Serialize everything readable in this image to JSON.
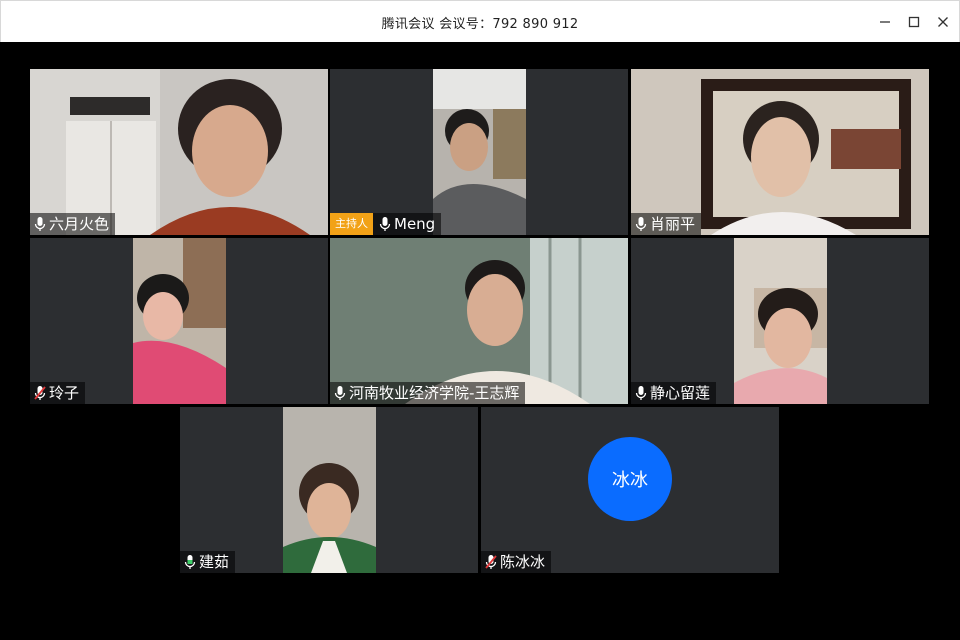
{
  "window": {
    "title": "腾讯会议 会议号：792 890 912"
  },
  "participants": [
    {
      "name": "六月火色",
      "mic": "on"
    },
    {
      "name": "Meng",
      "mic": "on",
      "host_badge": "主持人"
    },
    {
      "name": "肖丽平",
      "mic": "on"
    },
    {
      "name": "玲子",
      "mic": "muted"
    },
    {
      "name": "河南牧业经济学院-王志辉",
      "mic": "on"
    },
    {
      "name": "静心留莲",
      "mic": "on"
    },
    {
      "name": "建茹",
      "mic": "on"
    },
    {
      "name": "陈冰冰",
      "mic": "muted",
      "avatar_text": "冰冰",
      "avatar_color": "#0a6cff"
    }
  ],
  "colors": {
    "tile_bg": "#2c2e31",
    "host_badge": "#f2a217",
    "muted_mic": "#e0383a",
    "active_mic": "#ffffff"
  }
}
